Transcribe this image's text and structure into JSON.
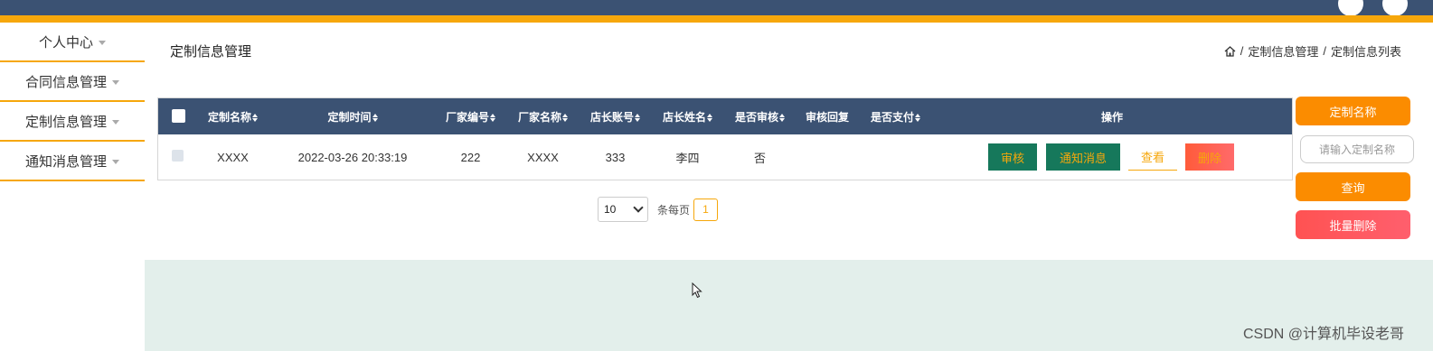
{
  "sidebar": {
    "items": [
      {
        "label": "个人中心"
      },
      {
        "label": "合同信息管理"
      },
      {
        "label": "定制信息管理"
      },
      {
        "label": "通知消息管理"
      }
    ]
  },
  "page": {
    "title": "定制信息管理",
    "breadcrumb": [
      "定制信息管理",
      "定制信息列表"
    ]
  },
  "table": {
    "headers": {
      "name": "定制名称",
      "time": "定制时间",
      "factory_no": "厂家编号",
      "factory_name": "厂家名称",
      "account": "店长账号",
      "manager": "店长姓名",
      "audit": "是否审核",
      "reply": "审核回复",
      "paid": "是否支付",
      "actions": "操作"
    },
    "rows": [
      {
        "name": "XXXX",
        "time": "2022-03-26 20:33:19",
        "factory_no": "222",
        "factory_name": "XXXX",
        "account": "333",
        "manager": "李四",
        "audit": "否",
        "reply": "",
        "paid": ""
      }
    ],
    "row_buttons": {
      "audit": "审核",
      "notify": "通知消息",
      "view": "查看",
      "delete": "删除"
    }
  },
  "pager": {
    "page_size": "10",
    "per_page_text": "条每页",
    "current_page": "1"
  },
  "right_panel": {
    "field_label": "定制名称",
    "input_placeholder": "请输入定制名称",
    "query_label": "查询",
    "batch_delete_label": "批量删除"
  },
  "watermark": "CSDN @计算机毕设老哥",
  "colors": {
    "header_bg": "#3b5273",
    "accent": "#f6a70b",
    "action_green": "#16785b",
    "orange_button": "#fb8c00",
    "red_button": "#ff5252",
    "footer_bg": "#e3efeb"
  }
}
